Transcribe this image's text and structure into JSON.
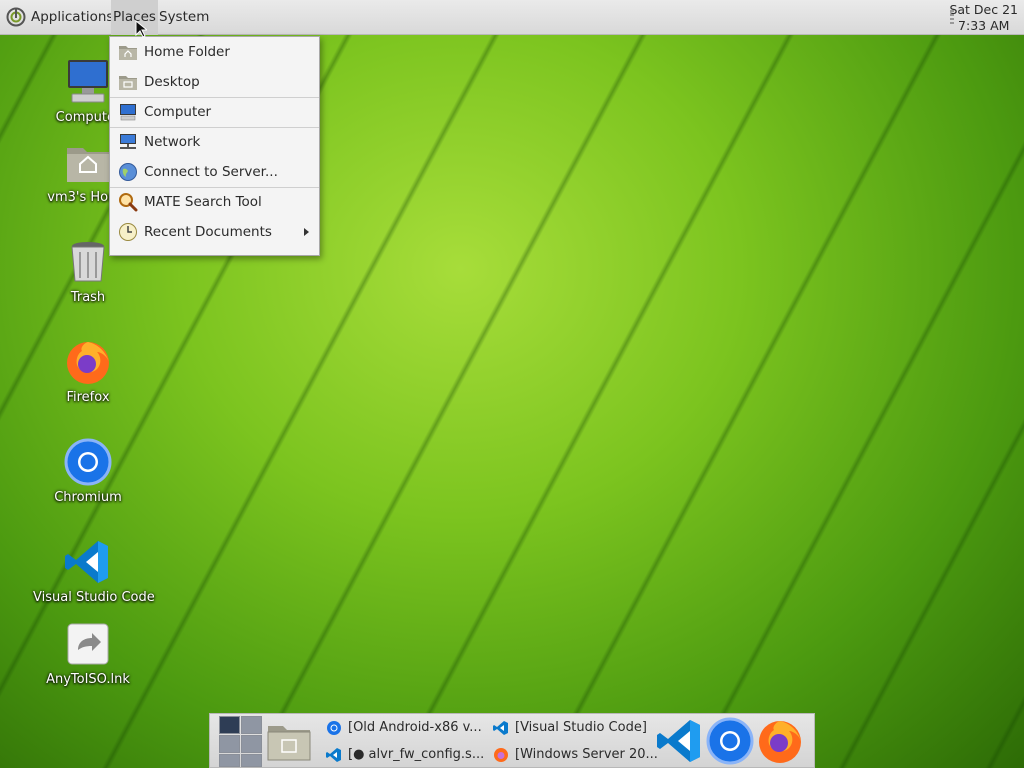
{
  "top_panel": {
    "menus": {
      "applications": "Applications",
      "places": "Places",
      "system": "System"
    },
    "clock": {
      "date": "Sat Dec 21",
      "time": "7:33 AM"
    }
  },
  "desktop_icons": [
    {
      "label": "Computer",
      "icon": "computer-icon"
    },
    {
      "label": "vm3's Home",
      "icon": "home-folder-icon"
    },
    {
      "label": "Trash",
      "icon": "trash-icon"
    },
    {
      "label": "Firefox",
      "icon": "firefox-icon"
    },
    {
      "label": "Chromium",
      "icon": "chromium-icon"
    },
    {
      "label": "Visual Studio Code",
      "icon": "vscode-icon"
    },
    {
      "label": "AnyToISO.lnk",
      "icon": "shortcut-icon"
    }
  ],
  "places_menu": {
    "items": [
      {
        "label": "Home Folder",
        "icon": "home-folder-icon"
      },
      {
        "label": "Desktop",
        "icon": "desktop-folder-icon"
      },
      {
        "label": "Computer",
        "icon": "computer-icon"
      },
      {
        "label": "Network",
        "icon": "network-icon"
      },
      {
        "label": "Connect to Server...",
        "icon": "globe-icon"
      },
      {
        "label": "MATE Search Tool",
        "icon": "search-icon"
      },
      {
        "label": "Recent Documents",
        "icon": "clock-icon"
      }
    ]
  },
  "taskbar": {
    "tasks": [
      {
        "label": "[Old Android-x86 v...",
        "icon": "chromium-icon"
      },
      {
        "label": "[Visual Studio Code]",
        "icon": "vscode-icon"
      },
      {
        "label": "[● alvr_fw_config.s...",
        "icon": "vscode-icon"
      },
      {
        "label": "[Windows Server 20...",
        "icon": "firefox-icon"
      }
    ],
    "launchers": [
      "vscode-icon",
      "chromium-icon",
      "firefox-icon"
    ]
  },
  "colors": {
    "panel": "#e0e0e0",
    "desktop_green": "#7cc41f",
    "menu_bg": "#f4f4f4",
    "vscode_blue": "#0a7acc"
  }
}
